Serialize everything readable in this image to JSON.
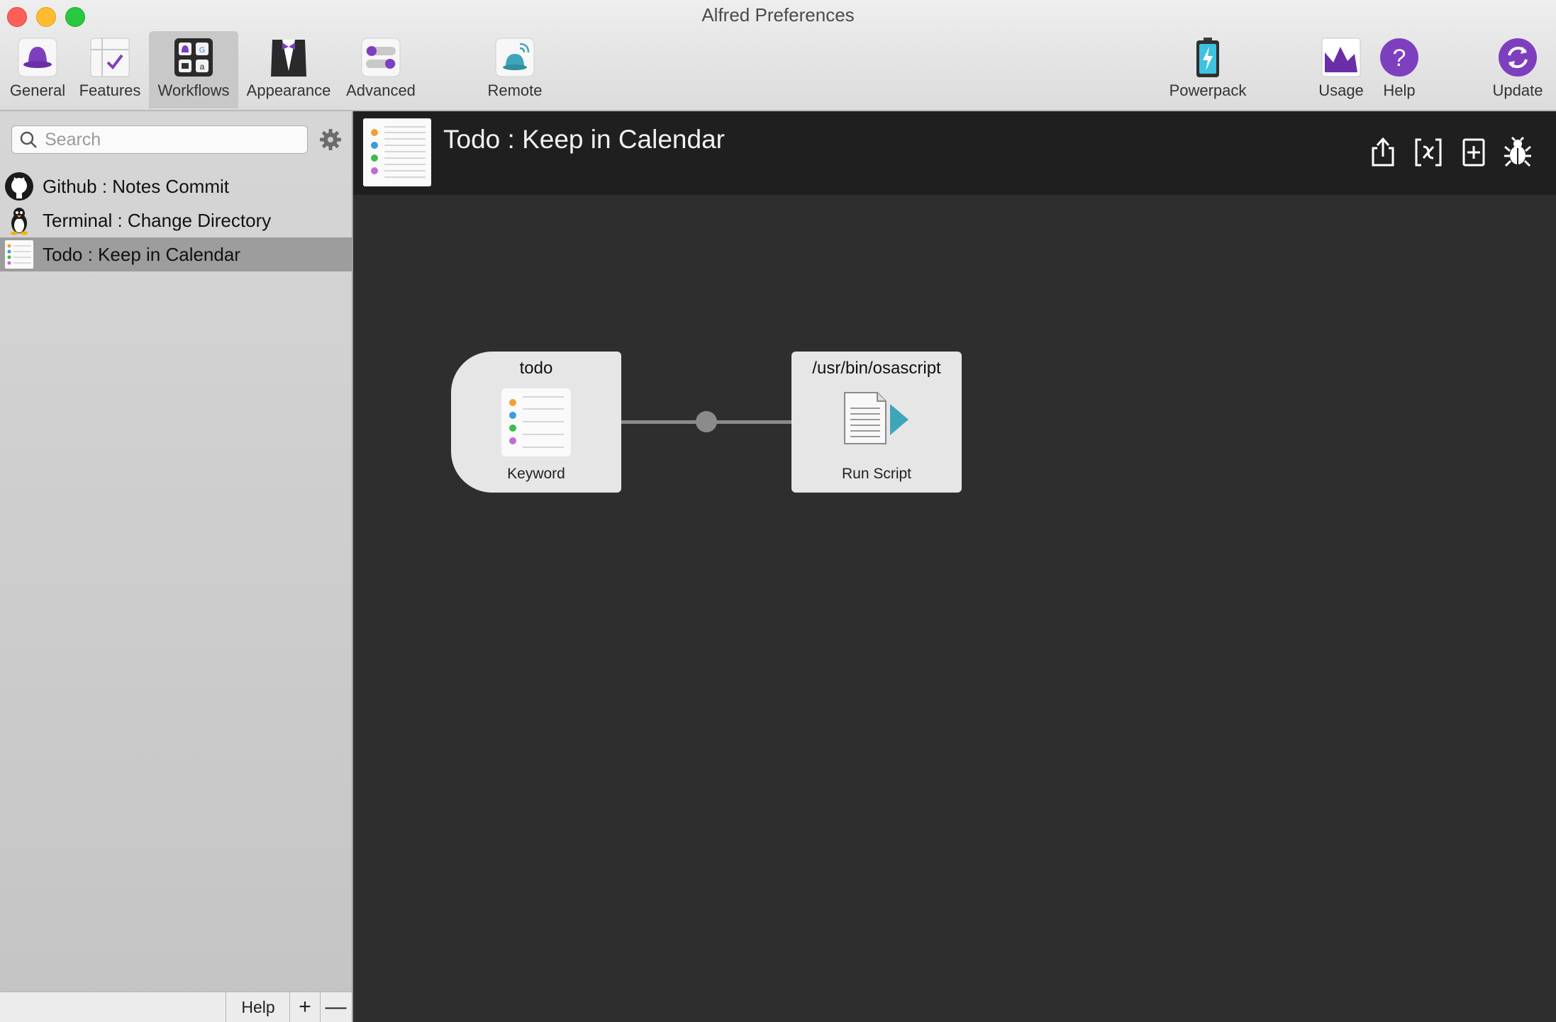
{
  "window": {
    "title": "Alfred Preferences"
  },
  "toolbar": {
    "items": [
      {
        "label": "General",
        "icon": "hat-icon"
      },
      {
        "label": "Features",
        "icon": "checklist-icon"
      },
      {
        "label": "Workflows",
        "icon": "workflows-icon",
        "active": true
      },
      {
        "label": "Appearance",
        "icon": "tuxedo-icon"
      },
      {
        "label": "Advanced",
        "icon": "toggles-icon"
      },
      {
        "label": "Remote",
        "icon": "remote-icon"
      },
      {
        "label": "Powerpack",
        "icon": "battery-icon"
      },
      {
        "label": "Usage",
        "icon": "usage-chart-icon"
      },
      {
        "label": "Help",
        "icon": "help-icon"
      },
      {
        "label": "Update",
        "icon": "update-icon"
      }
    ]
  },
  "sidebar": {
    "search": {
      "placeholder": "Search",
      "value": ""
    },
    "items": [
      {
        "label": "Github : Notes Commit",
        "icon": "github-icon"
      },
      {
        "label": "Terminal : Change Directory",
        "icon": "tux-penguin-icon"
      },
      {
        "label": "Todo : Keep in Calendar",
        "icon": "todo-list-icon",
        "selected": true
      }
    ],
    "bottom": {
      "help_label": "Help",
      "add_label": "+",
      "remove_label": "—"
    }
  },
  "workflow": {
    "title": "Todo : Keep in Calendar",
    "header_actions": [
      "export-icon",
      "variables-icon",
      "add-object-icon",
      "debug-bug-icon"
    ],
    "nodes": [
      {
        "title": "todo",
        "label": "Keyword",
        "icon": "todo-list-icon"
      },
      {
        "title": "/usr/bin/osascript",
        "label": "Run Script",
        "icon": "run-script-icon"
      }
    ]
  },
  "colors": {
    "accent_purple": "#7e3fbf",
    "selected_row": "#9d9d9d",
    "canvas_bg": "#2e2e2e",
    "header_bg": "#1f1f1f"
  }
}
